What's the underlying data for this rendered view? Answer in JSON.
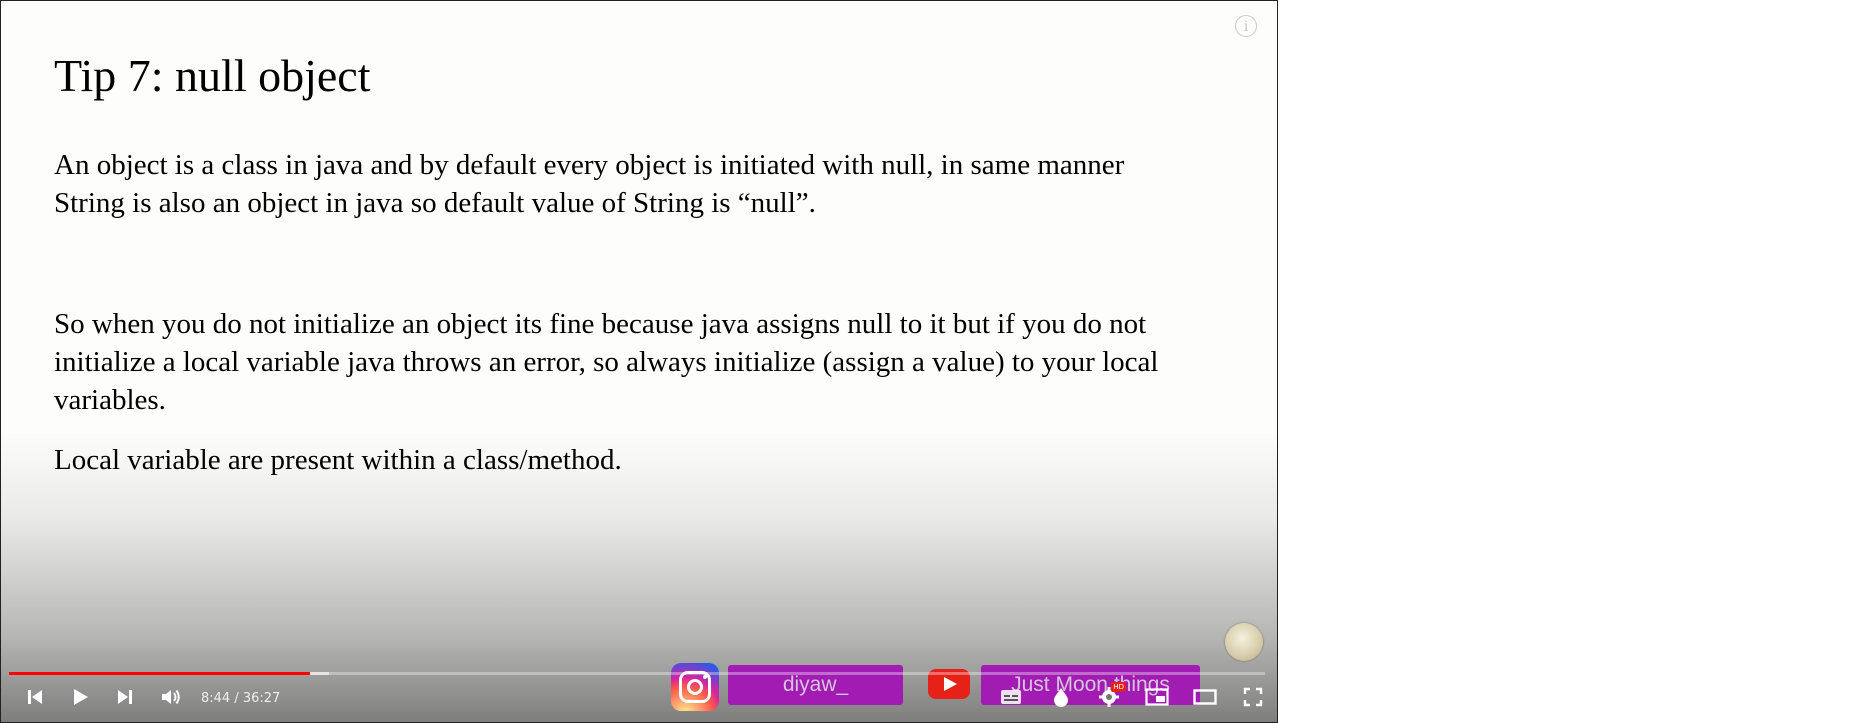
{
  "slide": {
    "title": "Tip 7: null object",
    "paragraph1": "An object is a class in java and by default every object is initiated with null, in same manner String is also an object in java so default value of String is “null”.",
    "paragraph2": "So when you do not initialize an object its fine because java assigns null to it but if you do not initialize a local variable java throws an error, so always initialize (assign a value) to your local variables.",
    "paragraph3": "Local variable are present within a class/method."
  },
  "player": {
    "time_display": "8:44 / 36:27",
    "played_fraction": 0.24,
    "buffered_fraction": 0.255,
    "hd_badge": "HD",
    "info_glyph": "i"
  },
  "promo": {
    "instagram_handle": "diyaw_",
    "youtube_channel": "Just Moon things"
  },
  "colors": {
    "progress_played": "#ff0000",
    "promo_pill": "#a21cb4",
    "youtube_red": "#e62117"
  },
  "icons": {
    "prev": "skip-previous-icon",
    "play": "play-icon",
    "next": "skip-next-icon",
    "volume": "volume-icon",
    "subtitles": "subtitles-icon",
    "ambient": "ambient-mode-icon",
    "settings": "gear-icon",
    "miniplayer": "miniplayer-icon",
    "theater": "theater-mode-icon",
    "fullscreen": "fullscreen-icon"
  }
}
